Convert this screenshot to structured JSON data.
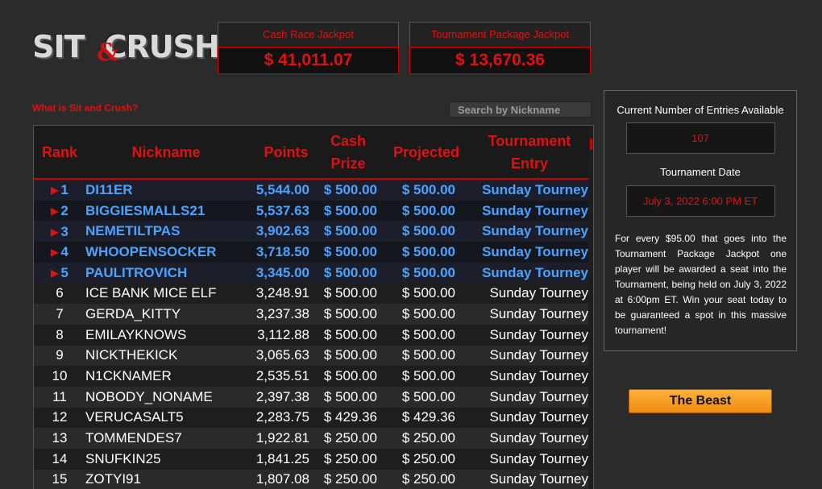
{
  "logo": {
    "text_left": "SIT",
    "amp": "&",
    "text_right": "CRUSH"
  },
  "jackpots": [
    {
      "title": "Cash Race Jackpot",
      "value": "$ 41,011.07"
    },
    {
      "title": "Tournament Package Jackpot",
      "value": "$ 13,670.36"
    }
  ],
  "what_link": "What is Sit and Crush?",
  "search": {
    "placeholder": "Search by Nickname"
  },
  "table": {
    "headers": {
      "rank": "Rank",
      "nickname": "Nickname",
      "points": "Points",
      "cash_prize": "Cash Prize",
      "projected": "Projected",
      "tournament_entry": "Tournament Entry"
    },
    "rows": [
      {
        "rank": "1",
        "nickname": "DI11ER",
        "points": "5,544.00",
        "cash": "$ 500.00",
        "projected": "$ 500.00",
        "entry": "Sunday Tourney",
        "top": true
      },
      {
        "rank": "2",
        "nickname": "BIGGIESMALLS21",
        "points": "5,537.63",
        "cash": "$ 500.00",
        "projected": "$ 500.00",
        "entry": "Sunday Tourney",
        "top": true
      },
      {
        "rank": "3",
        "nickname": "NEMETILTPAS",
        "points": "3,902.63",
        "cash": "$ 500.00",
        "projected": "$ 500.00",
        "entry": "Sunday Tourney",
        "top": true
      },
      {
        "rank": "4",
        "nickname": "WHOOPENSOCKER",
        "points": "3,718.50",
        "cash": "$ 500.00",
        "projected": "$ 500.00",
        "entry": "Sunday Tourney",
        "top": true
      },
      {
        "rank": "5",
        "nickname": "PAULITROVICH",
        "points": "3,345.00",
        "cash": "$ 500.00",
        "projected": "$ 500.00",
        "entry": "Sunday Tourney",
        "top": true
      },
      {
        "rank": "6",
        "nickname": "ICE BANK MICE ELF",
        "points": "3,248.91",
        "cash": "$ 500.00",
        "projected": "$ 500.00",
        "entry": "Sunday Tourney",
        "top": false
      },
      {
        "rank": "7",
        "nickname": "GERDA_KITTY",
        "points": "3,237.38",
        "cash": "$ 500.00",
        "projected": "$ 500.00",
        "entry": "Sunday Tourney",
        "top": false
      },
      {
        "rank": "8",
        "nickname": "EMILAYKNOWS",
        "points": "3,112.88",
        "cash": "$ 500.00",
        "projected": "$ 500.00",
        "entry": "Sunday Tourney",
        "top": false
      },
      {
        "rank": "9",
        "nickname": "NICKTHEKICK",
        "points": "3,065.63",
        "cash": "$ 500.00",
        "projected": "$ 500.00",
        "entry": "Sunday Tourney",
        "top": false
      },
      {
        "rank": "10",
        "nickname": "N1CKNAMER",
        "points": "2,535.51",
        "cash": "$ 500.00",
        "projected": "$ 500.00",
        "entry": "Sunday Tourney",
        "top": false
      },
      {
        "rank": "11",
        "nickname": "NOBODY_NONAME",
        "points": "2,397.38",
        "cash": "$ 500.00",
        "projected": "$ 500.00",
        "entry": "Sunday Tourney",
        "top": false
      },
      {
        "rank": "12",
        "nickname": "VERUCASALT5",
        "points": "2,283.75",
        "cash": "$ 429.36",
        "projected": "$ 429.36",
        "entry": "Sunday Tourney",
        "top": false
      },
      {
        "rank": "13",
        "nickname": "TOMMENDES7",
        "points": "1,922.81",
        "cash": "$ 250.00",
        "projected": "$ 250.00",
        "entry": "Sunday Tourney",
        "top": false
      },
      {
        "rank": "14",
        "nickname": "SNUFKIN25",
        "points": "1,841.25",
        "cash": "$ 250.00",
        "projected": "$ 250.00",
        "entry": "Sunday Tourney",
        "top": false
      },
      {
        "rank": "15",
        "nickname": "ZOTYI91",
        "points": "1,807.08",
        "cash": "$ 250.00",
        "projected": "$ 250.00",
        "entry": "Sunday Tourney",
        "top": false
      }
    ]
  },
  "panel": {
    "entries_label": "Current Number of Entries Available",
    "entries_value": "107",
    "date_label": "Tournament Date",
    "date_value": "July 3, 2022 6:00 PM ET",
    "description": "For every $95.00 that goes into the Tournament Package Jackpot one player will be awarded a seat into the Tournament, being held on July 3, 2022 at 6:00pm ET. Win your seat today to be guaranteed a spot in this massive tournament!"
  },
  "beast_button": "The Beast",
  "colors": {
    "accent_red": "#e01010",
    "top_blue": "#4aa3ff",
    "button_orange": "#f5a020"
  }
}
